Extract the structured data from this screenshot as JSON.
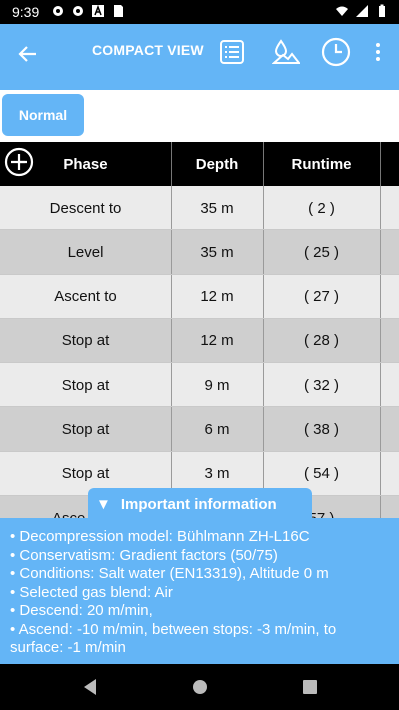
{
  "status_bar": {
    "time": "9:39"
  },
  "app_bar": {
    "title": "COMPACT VIEW"
  },
  "mode_button": {
    "label": "Normal"
  },
  "table": {
    "headers": [
      "Phase",
      "Depth",
      "Runtime"
    ],
    "rows": [
      {
        "phase": "Descent to",
        "depth": "35 m",
        "runtime": "( 2 )"
      },
      {
        "phase": "Level",
        "depth": "35 m",
        "runtime": "( 25 )"
      },
      {
        "phase": "Ascent to",
        "depth": "12 m",
        "runtime": "( 27 )"
      },
      {
        "phase": "Stop at",
        "depth": "12 m",
        "runtime": "( 28 )"
      },
      {
        "phase": "Stop at",
        "depth": "9 m",
        "runtime": "( 32 )"
      },
      {
        "phase": "Stop at",
        "depth": "6 m",
        "runtime": "( 38 )"
      },
      {
        "phase": "Stop at",
        "depth": "3 m",
        "runtime": "( 54 )"
      },
      {
        "phase": "Asce",
        "depth": "",
        "runtime": "57 )"
      }
    ]
  },
  "info": {
    "tab_label": "Important information",
    "lines": [
      "• Decompression model: Bühlmann ZH-L16C",
      "• Conservatism: Gradient factors (50/75)",
      "• Conditions: Salt water (EN13319), Altitude 0 m",
      "• Selected gas blend: Air",
      "• Descend: 20 m/min,",
      "• Ascend: -10 m/min, between stops: -3 m/min, to",
      "surface: -1 m/min"
    ]
  },
  "colors": {
    "accent": "#64b5f6",
    "header_bg": "#000000",
    "row_light": "#ebebeb",
    "row_dark": "#cfcfcf"
  }
}
